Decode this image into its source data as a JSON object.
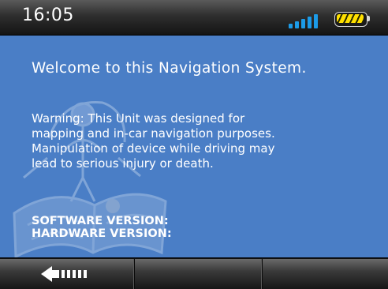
{
  "status_bar": {
    "time": "16:05",
    "signal_icon": "signal-strength-icon",
    "signal_level": 1.0,
    "battery_icon": "battery-icon",
    "battery_level": 1.0,
    "colors": {
      "signal": "#1c9be8",
      "battery": "#ffe000"
    }
  },
  "main": {
    "welcome": "Welcome to this  Navigation System.",
    "warning": "Warning: This Unit was designed for\nmapping and in-car navigation purposes.\nManipulation of device while driving may\nlead to serious injury or death.",
    "software_version_label": "SOFTWARE VERSION:",
    "hardware_version_label": "HARDWARE VERSION:",
    "background_color": "#4a7ec6"
  },
  "toolbar": {
    "back_icon": "back-arrow-icon"
  }
}
